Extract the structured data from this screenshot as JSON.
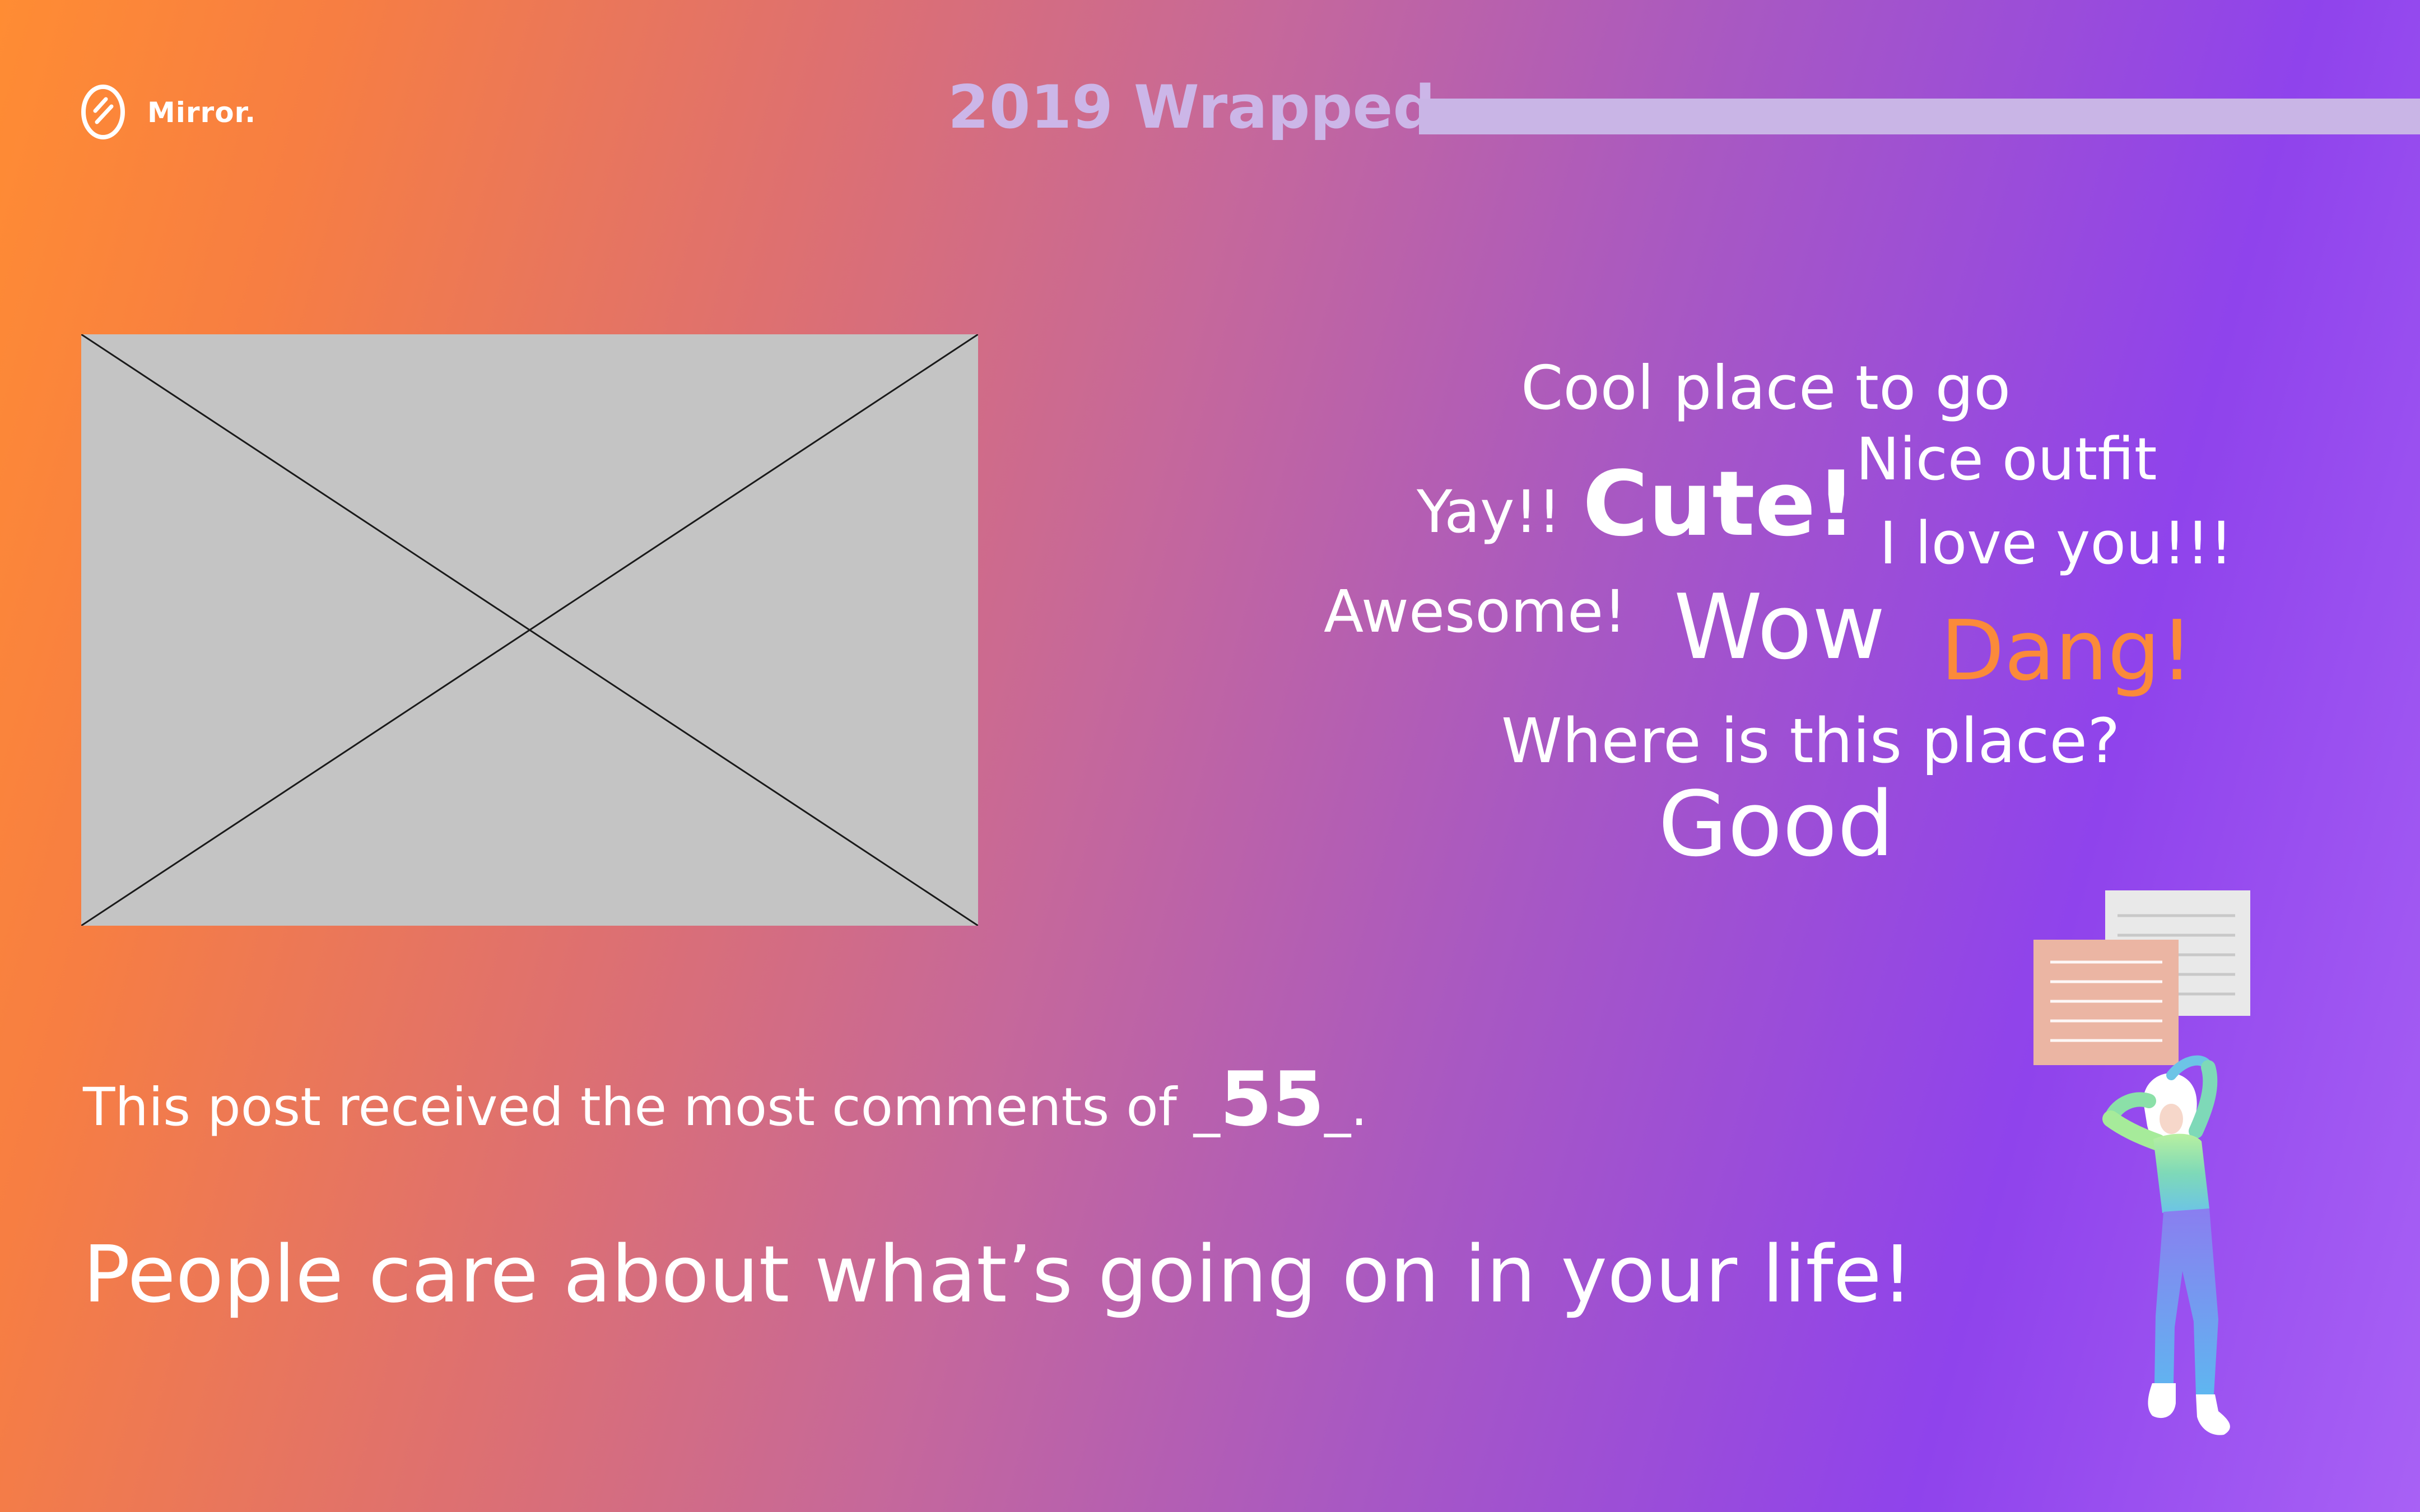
{
  "brand": {
    "name": "Mirror.",
    "logo_icon": "mirror-logo-icon"
  },
  "header": {
    "title": "2019 Wrapped"
  },
  "colors": {
    "gradient_start": "#ff8c33",
    "gradient_end": "#8f43ec",
    "highlight_word": "#fb8a3a",
    "placeholder_fill": "#c4c4c4",
    "header_accent": "#c9b5e6"
  },
  "media": {
    "placeholder_icon": "image-placeholder-icon"
  },
  "word_cloud": {
    "words": {
      "cool": "Cool place to go",
      "nice": "Nice outfit",
      "yay": "Yay!!",
      "cute": "Cute!",
      "love": "I love you!!!",
      "awesome": "Awesome!",
      "wow": "Wow",
      "dang": "Dang!",
      "where": "Where is this place?",
      "good": "Good"
    }
  },
  "caption": {
    "prefix": "This post received the most comments of _",
    "count": "55",
    "suffix": "_."
  },
  "headline": "People care about what’s going on in your life!",
  "illustration": {
    "icon": "person-reading-messages-illustration"
  }
}
